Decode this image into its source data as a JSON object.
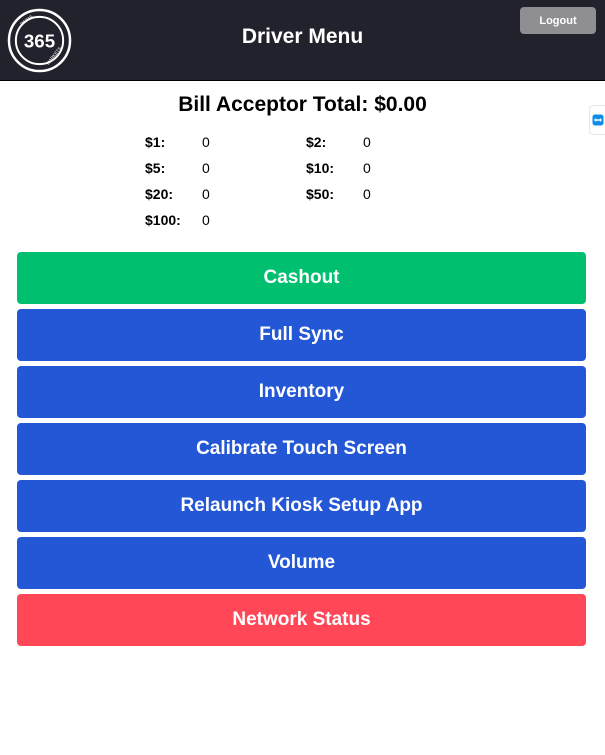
{
  "header": {
    "logo": {
      "number": "365",
      "top_text": "RETAIL",
      "bottom_text": "MARKETS"
    },
    "title": "Driver Menu",
    "logout_label": "Logout"
  },
  "bill_acceptor": {
    "title": "Bill Acceptor Total: $0.00",
    "denominations": [
      {
        "label": "$1:",
        "value": "0"
      },
      {
        "label": "$2:",
        "value": "0"
      },
      {
        "label": "$5:",
        "value": "0"
      },
      {
        "label": "$10:",
        "value": "0"
      },
      {
        "label": "$20:",
        "value": "0"
      },
      {
        "label": "$50:",
        "value": "0"
      },
      {
        "label": "$100:",
        "value": "0"
      }
    ]
  },
  "side_tab": {
    "icon": "teamviewer-icon"
  },
  "menu": {
    "buttons": [
      {
        "label": "Cashout",
        "color": "#00bf6f"
      },
      {
        "label": "Full Sync",
        "color": "#2457d6"
      },
      {
        "label": "Inventory",
        "color": "#2457d6"
      },
      {
        "label": "Calibrate Touch Screen",
        "color": "#2457d6"
      },
      {
        "label": "Relaunch Kiosk Setup App",
        "color": "#2457d6"
      },
      {
        "label": "Volume",
        "color": "#2457d6"
      },
      {
        "label": "Network Status",
        "color": "#ff4757"
      }
    ]
  }
}
